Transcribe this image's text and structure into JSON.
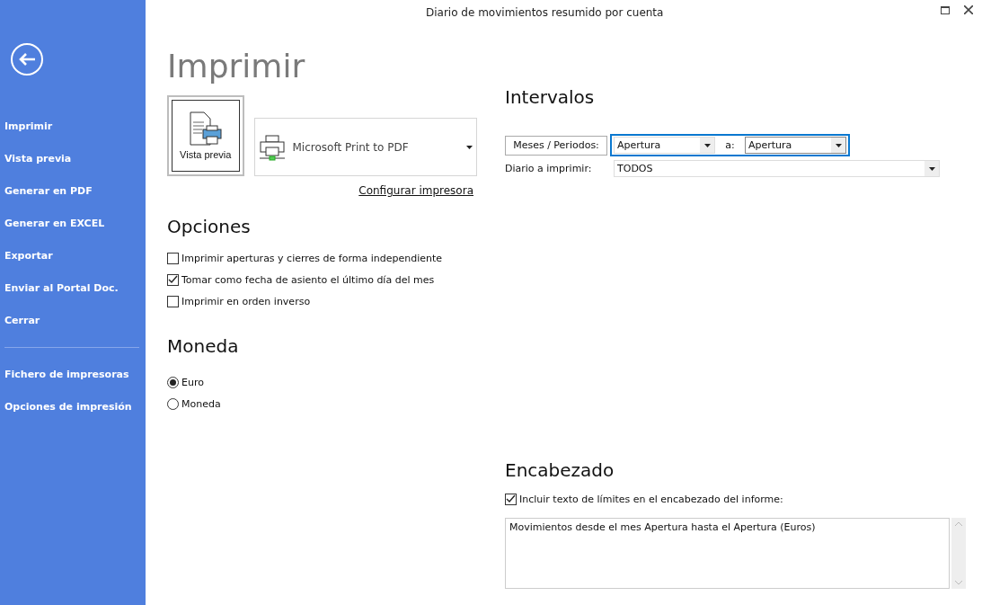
{
  "window": {
    "title": "Diario de movimientos resumido por cuenta"
  },
  "sidebar": {
    "groups": [
      {
        "items": [
          "Imprimir",
          "Vista previa",
          "Generar en PDF",
          "Generar en EXCEL",
          "Exportar",
          "Enviar al Portal Doc.",
          "Cerrar"
        ]
      },
      {
        "items": [
          "Fichero de impresoras",
          "Opciones de impresión"
        ]
      }
    ]
  },
  "print": {
    "title": "Imprimir",
    "preview_button": "Vista previa",
    "printer": "Microsoft Print to PDF",
    "configure_link": "Configurar impresora"
  },
  "options": {
    "title": "Opciones",
    "items": [
      {
        "label": "Imprimir aperturas y cierres de forma independiente",
        "checked": false
      },
      {
        "label": "Tomar como fecha de asiento el último día del mes",
        "checked": true
      },
      {
        "label": "Imprimir en orden inverso",
        "checked": false
      }
    ]
  },
  "currency": {
    "title": "Moneda",
    "items": [
      {
        "label": "Euro",
        "selected": true
      },
      {
        "label": "Moneda",
        "selected": false
      }
    ]
  },
  "intervals": {
    "title": "Intervalos",
    "periods_button": "Meses / Periodos:",
    "from": "Apertura",
    "to_label": "a:",
    "to": "Apertura",
    "journal_label": "Diario a imprimir:",
    "journal": "TODOS"
  },
  "header": {
    "title": "Encabezado",
    "include": {
      "label": "Incluir texto de límites en el encabezado del informe:",
      "checked": true
    },
    "text": "Movimientos desde el mes Apertura hasta el Apertura (Euros)"
  }
}
